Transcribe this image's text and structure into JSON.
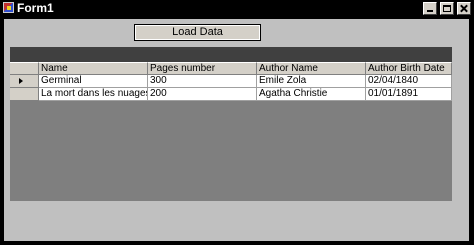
{
  "window": {
    "title": "Form1"
  },
  "toolbar": {
    "load_label": "Load Data"
  },
  "grid": {
    "columns": [
      "Name",
      "Pages number",
      "Author Name",
      "Author Birth Date"
    ],
    "rows": [
      [
        "Germinal",
        "300",
        "Emile Zola",
        "02/04/1840"
      ],
      [
        "La mort dans les nuages",
        "200",
        "Agatha Christie",
        "01/01/1891"
      ]
    ]
  }
}
